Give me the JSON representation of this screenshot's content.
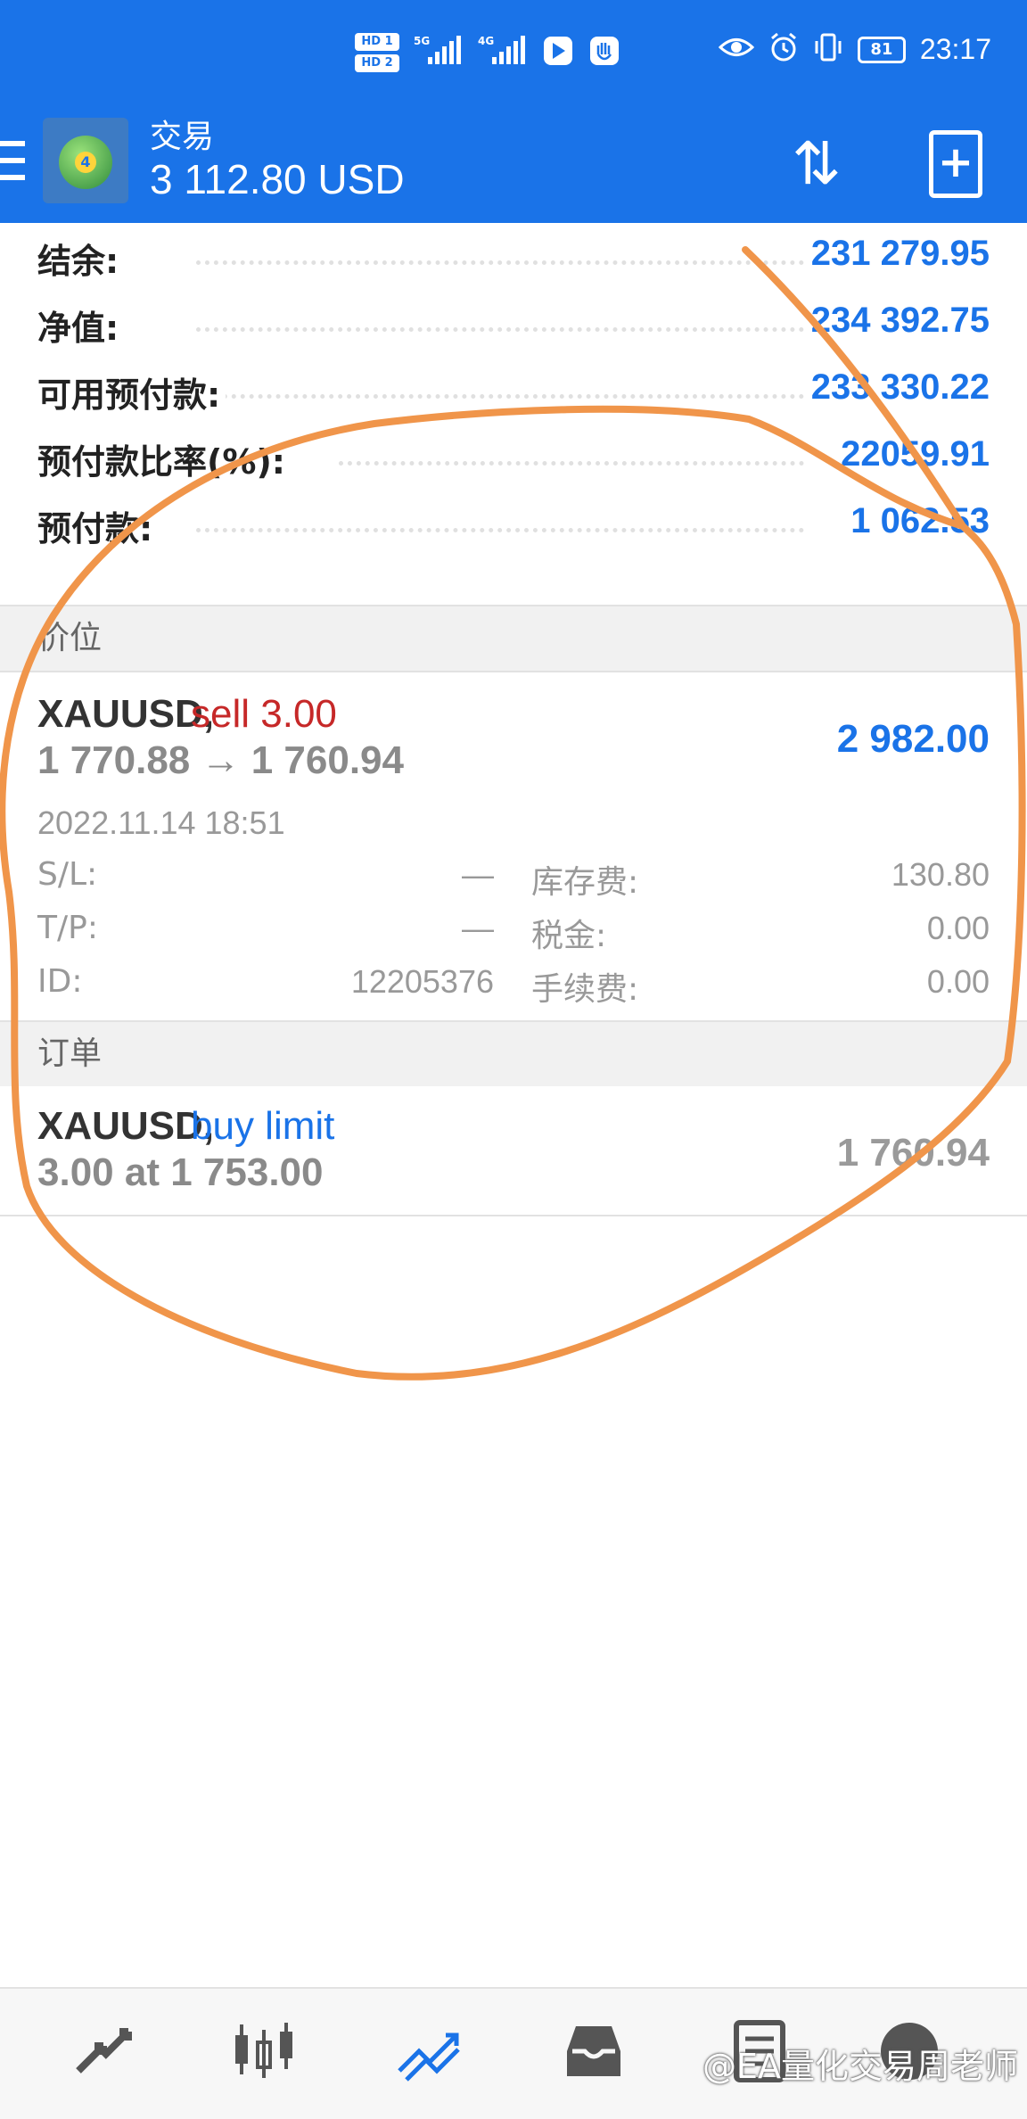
{
  "status_bar": {
    "hd1": "HD 1",
    "hd2": "HD 2",
    "net1": "5G",
    "net2": "4G",
    "battery": "81",
    "time": "23:17"
  },
  "app_bar": {
    "title": "交易",
    "balance": "3 112.80 USD",
    "logo_text": "4"
  },
  "summary": [
    {
      "label": "结余:",
      "value": "231 279.95"
    },
    {
      "label": "净值:",
      "value": "234 392.75"
    },
    {
      "label": "可用预付款:",
      "value": "233 330.22"
    },
    {
      "label": "预付款比率(%):",
      "value": "22059.91"
    },
    {
      "label": "预付款:",
      "value": "1 062.53"
    }
  ],
  "positions_header": "价位",
  "position": {
    "symbol": "XAUUSD,",
    "side": "sell 3.00",
    "prices": "1 770.88 → 1 760.94",
    "profit": "2 982.00",
    "time": "2022.11.14 18:51",
    "sl_label": "S/L:",
    "sl_value": "—",
    "tp_label": "T/P:",
    "tp_value": "—",
    "id_label": "ID:",
    "id_value": "12205376",
    "swap_label": "库存费:",
    "swap_value": "130.80",
    "tax_label": "税金:",
    "tax_value": "0.00",
    "commission_label": "手续费:",
    "commission_value": "0.00"
  },
  "orders_header": "订单",
  "order": {
    "symbol": "XAUUSD,",
    "type": "buy limit",
    "detail": "3.00 at 1 753.00",
    "price": "1 760.94"
  },
  "watermark": "@EA量化交易周老师",
  "colors": {
    "brand_blue": "#1a73e8",
    "sell_red": "#c62828",
    "annotation_orange": "#f0954a"
  },
  "icons": {
    "nav": [
      "quotes-arrows-icon",
      "chart-candles-icon",
      "trade-chart-icon",
      "history-inbox-icon",
      "news-doc-icon",
      "chat-icon"
    ]
  }
}
